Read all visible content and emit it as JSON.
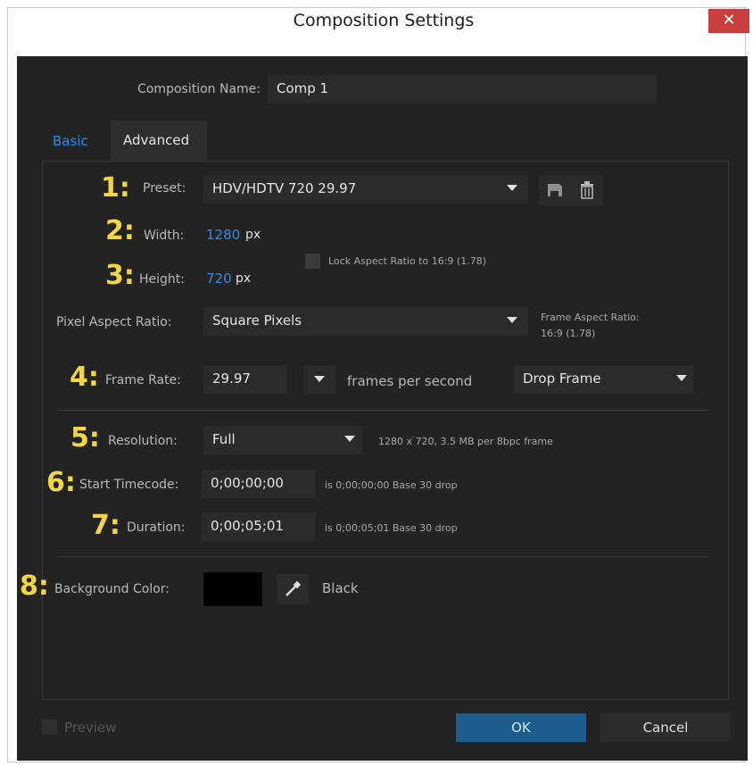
{
  "window": {
    "title": "Composition Settings",
    "close_glyph": "✕"
  },
  "comp_name": {
    "label": "Composition Name:",
    "value": "Comp 1"
  },
  "tabs": [
    {
      "label": "Basic"
    },
    {
      "label": "Advanced"
    }
  ],
  "annotations": [
    "1:",
    "2:",
    "3:",
    "4:",
    "5:",
    "6:",
    "7:",
    "8:"
  ],
  "preset": {
    "label": "Preset:",
    "value": "HDV/HDTV 720 29.97"
  },
  "width": {
    "label": "Width:",
    "value": "1280",
    "unit": "px"
  },
  "height": {
    "label": "Height:",
    "value": "720",
    "unit": "px"
  },
  "lock_aspect": {
    "label": "Lock Aspect Ratio to 16:9 (1.78)"
  },
  "pixel_aspect": {
    "label": "Pixel Aspect Ratio:",
    "value": "Square Pixels"
  },
  "frame_aspect": {
    "label": "Frame Aspect Ratio:",
    "value": "16:9 (1.78)"
  },
  "frame_rate": {
    "label": "Frame Rate:",
    "value": "29.97",
    "unit": "frames per second",
    "mode": "Drop Frame"
  },
  "resolution": {
    "label": "Resolution:",
    "value": "Full",
    "info": "1280 x 720, 3.5 MB per 8bpc frame"
  },
  "start_timecode": {
    "label": "Start Timecode:",
    "value": "0;00;00;00",
    "info": "is 0;00;00;00  Base 30  drop"
  },
  "duration": {
    "label": "Duration:",
    "value": "0;00;05;01",
    "info": "is 0;00;05;01  Base 30  drop"
  },
  "background": {
    "label": "Background Color:",
    "color_name": "Black",
    "swatch_color": "#000000",
    "picker_icon": "eyedropper-icon"
  },
  "footer": {
    "preview_label": "Preview",
    "ok_label": "OK",
    "cancel_label": "Cancel"
  },
  "colors": {
    "dialog_bg": "#232323",
    "accent_blue": "#2d8ceb",
    "ok_button": "#1c5d8e",
    "annotation_yellow": "#f2d644",
    "close_red": "#c7403c"
  }
}
